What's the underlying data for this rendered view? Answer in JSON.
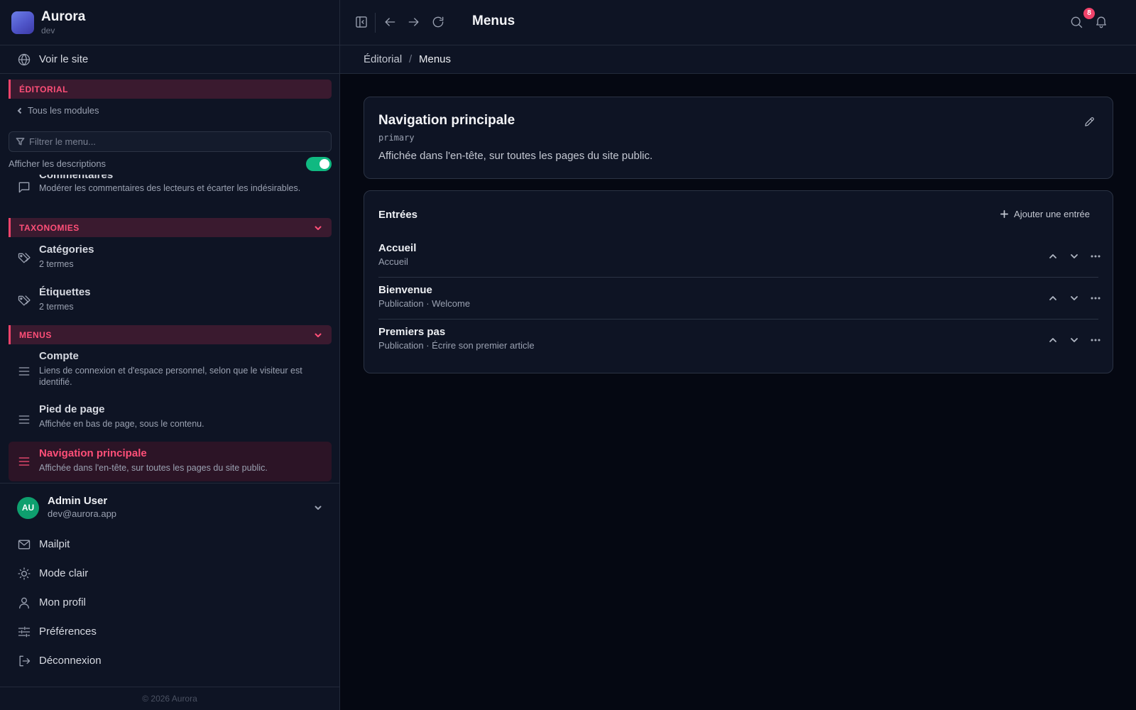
{
  "brand": {
    "name": "Aurora",
    "env": "dev"
  },
  "sidebar": {
    "visit_site": "Voir le site",
    "module_header": "ÉDITORIAL",
    "back_label": "Tous les modules",
    "filter_placeholder": "Filtrer le menu...",
    "show_descriptions_label": "Afficher les descriptions",
    "show_descriptions_on": true,
    "partial_item": {
      "title": "Commentaires",
      "description": "Modérer les commentaires des lecteurs et écarter les indésirables."
    },
    "sections": [
      {
        "label": "TAXONOMIES",
        "items": [
          {
            "title": "Catégories",
            "description": "2 termes"
          },
          {
            "title": "Étiquettes",
            "description": "2 termes"
          }
        ]
      },
      {
        "label": "MENUS",
        "items": [
          {
            "title": "Compte",
            "description": "Liens de connexion et d'espace personnel, selon que le visiteur est identifié."
          },
          {
            "title": "Pied de page",
            "description": "Affichée en bas de page, sous le contenu."
          },
          {
            "title": "Navigation principale",
            "description": "Affichée dans l'en-tête, sur toutes les pages du site public.",
            "active": true
          }
        ]
      }
    ],
    "user": {
      "initials": "AU",
      "name": "Admin User",
      "email": "dev@aurora.app"
    },
    "footer_links": [
      "Mailpit",
      "Mode clair",
      "Mon profil",
      "Préférences",
      "Déconnexion"
    ],
    "copyright": "© 2026 Aurora"
  },
  "topbar": {
    "title": "Menus",
    "notification_count": "8"
  },
  "breadcrumb": {
    "parent": "Éditorial",
    "separator": "/",
    "current": "Menus"
  },
  "menu_card": {
    "title": "Navigation principale",
    "code": "primary",
    "description": "Affichée dans l'en-tête, sur toutes les pages du site public."
  },
  "entries": {
    "heading": "Entrées",
    "add_label": "Ajouter une entrée",
    "rows": [
      {
        "title": "Accueil",
        "subtitle": "Accueil"
      },
      {
        "title": "Bienvenue",
        "subtitle": "Publication · Welcome"
      },
      {
        "title": "Premiers pas",
        "subtitle": "Publication · Écrire son premier article"
      }
    ]
  },
  "colors": {
    "accent": "#f0436b",
    "toggle_on": "#10b981",
    "avatar": "#0e9f6e",
    "sidebar_bg": "#0e1424",
    "main_bg": "#050812"
  },
  "icons": {
    "visit_site": "globe-icon",
    "comments": "message-square-icon",
    "taxonomy": "tag-icon",
    "menu": "list-icon",
    "footer": [
      "mail-icon",
      "sun-icon",
      "user-icon",
      "sliders-icon",
      "logout-icon"
    ]
  }
}
